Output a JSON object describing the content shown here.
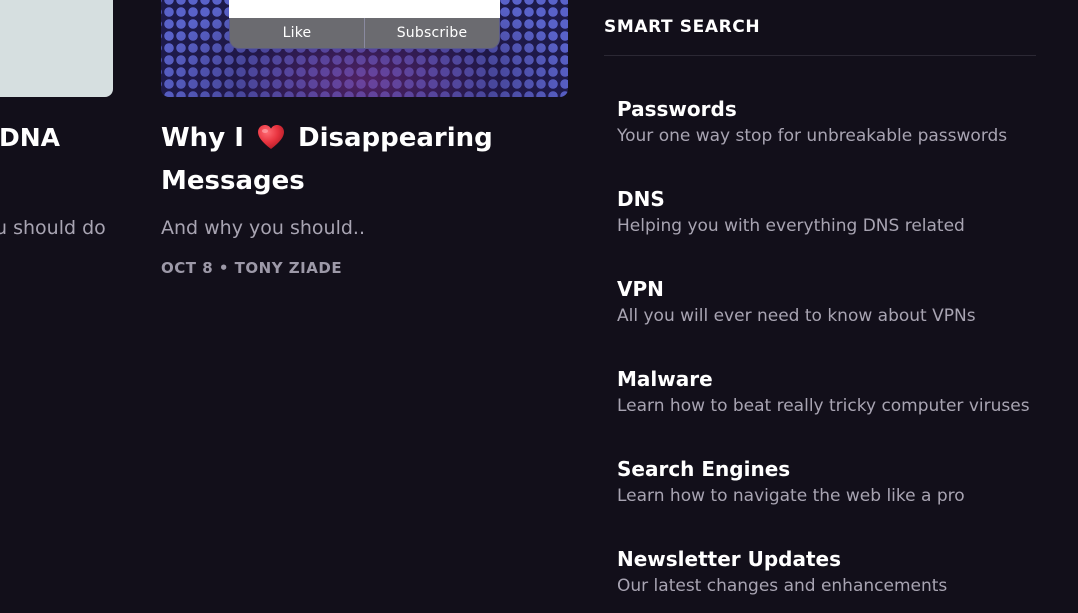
{
  "left_card": {
    "title_fragment": "DNA",
    "subtitle_fragment": "u should do"
  },
  "post": {
    "thumbnail": {
      "like_label": "Like",
      "subscribe_label": "Subscribe"
    },
    "title_before": "Why I",
    "title_icon": "heart-icon",
    "title_after": "Disappearing Messages",
    "subtitle": "And why you should..",
    "meta": "OCT 8 • TONY ZIADE"
  },
  "sidebar": {
    "heading": "SMART SEARCH",
    "items": [
      {
        "title": "Passwords",
        "description": "Your one way stop for unbreakable passwords"
      },
      {
        "title": "DNS",
        "description": "Helping you with everything DNS related"
      },
      {
        "title": "VPN",
        "description": "All you will ever need to know about VPNs"
      },
      {
        "title": "Malware",
        "description": "Learn how to beat really tricky computer viruses"
      },
      {
        "title": "Search Engines",
        "description": "Learn how to navigate the web like a pro"
      },
      {
        "title": "Newsletter Updates",
        "description": "Our latest changes and enhancements"
      }
    ]
  },
  "colors": {
    "background": "#120f1a",
    "text_primary": "#ffffff",
    "text_secondary": "#a8a4b2",
    "heart": "#e8333f"
  }
}
